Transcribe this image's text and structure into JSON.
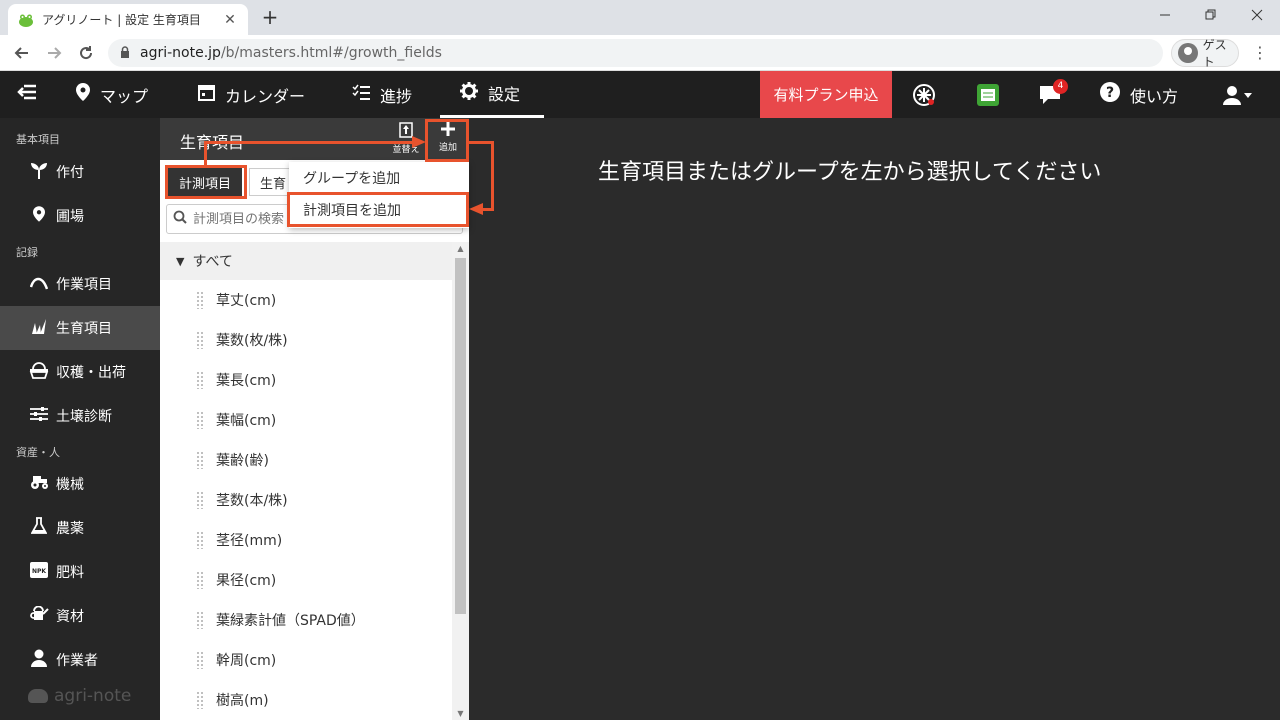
{
  "browser": {
    "tab_title": "アグリノート | 設定 生育項目",
    "tab_close": "✕",
    "new_tab": "+",
    "url_host": "agri-note.jp",
    "url_path": "/b/masters.html#/growth_fields",
    "profile_label": "ゲスト"
  },
  "header": {
    "nav": [
      {
        "label": "マップ"
      },
      {
        "label": "カレンダー"
      },
      {
        "label": "進捗"
      },
      {
        "label": "設定"
      }
    ],
    "upgrade_label": "有料プラン申込",
    "notification_count": "4",
    "help_label": "使い方"
  },
  "sidebar": {
    "sections": [
      {
        "label": "基本項目"
      },
      {
        "label": "記録"
      },
      {
        "label": "資産・人"
      }
    ],
    "items": [
      {
        "label": "作付"
      },
      {
        "label": "圃場"
      },
      {
        "label": "作業項目"
      },
      {
        "label": "生育項目"
      },
      {
        "label": "収穫・出荷"
      },
      {
        "label": "土壌診断"
      },
      {
        "label": "機械"
      },
      {
        "label": "農薬"
      },
      {
        "label": "肥料"
      },
      {
        "label": "資材"
      },
      {
        "label": "作業者"
      }
    ],
    "brand": "agri-note"
  },
  "panel": {
    "title": "生育項目",
    "sort_label": "並替え",
    "add_label": "追加",
    "tabs": [
      {
        "label": "計測項目"
      },
      {
        "label": "生育"
      }
    ],
    "search_placeholder": "計測項目の検索",
    "group_label": "すべて",
    "items": [
      "草丈(cm)",
      "葉数(枚/株)",
      "葉長(cm)",
      "葉幅(cm)",
      "葉齢(齢)",
      "茎数(本/株)",
      "茎径(mm)",
      "果径(cm)",
      "葉緑素計値（SPAD値）",
      "幹周(cm)",
      "樹高(m)"
    ]
  },
  "dropdown": {
    "items": [
      {
        "label": "グループを追加"
      },
      {
        "label": "計測項目を追加"
      }
    ]
  },
  "main": {
    "message": "生育項目またはグループを左から選択してください"
  },
  "colors": {
    "accent": "#e8532d",
    "upgrade": "#e8484b",
    "header_bg": "#1f1f1f"
  }
}
